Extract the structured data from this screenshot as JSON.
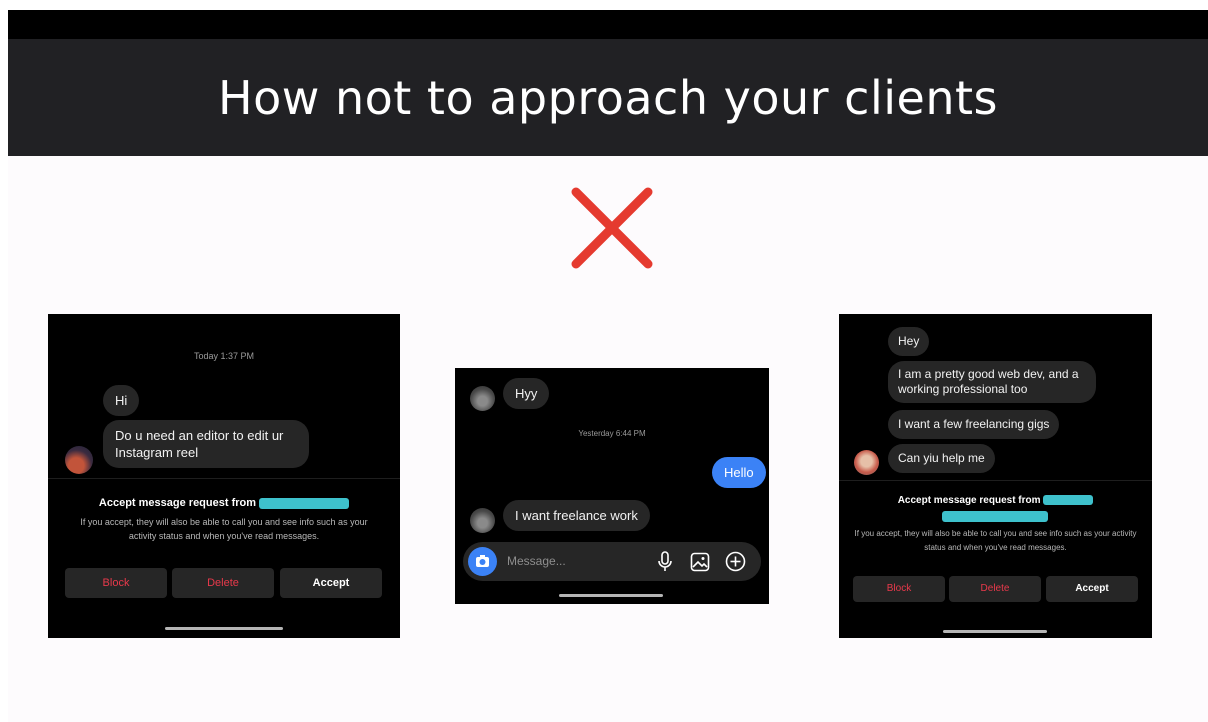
{
  "slide": {
    "title": "How not to approach your clients"
  },
  "colors": {
    "header_bg": "#212124",
    "x_mark": "#e53a2f",
    "sent_bubble": "#3b82f6",
    "danger": "#e8394b",
    "redaction": "#3ec1cc"
  },
  "shot1": {
    "timestamp": "Today 1:37 PM",
    "messages": [
      "Hi",
      "Do u need an editor to edit ur Instagram reel"
    ],
    "request_title": "Accept message request from",
    "request_body": "If you accept, they will also be able to call you and see info such as your activity status and when you've read messages.",
    "buttons": {
      "block": "Block",
      "delete": "Delete",
      "accept": "Accept"
    }
  },
  "shot2": {
    "received_1": "Hyy",
    "timestamp": "Yesterday 6:44 PM",
    "sent": "Hello",
    "received_2": "I want freelance work",
    "composer_placeholder": "Message..."
  },
  "shot3": {
    "messages": [
      "Hey",
      "I am a pretty good web dev, and a working professional too",
      "I want a few freelancing gigs",
      "Can yiu help me"
    ],
    "request_title": "Accept message request from",
    "request_body": "If you accept, they will also be able to call you and see info such as your activity status and when you've read messages.",
    "buttons": {
      "block": "Block",
      "delete": "Delete",
      "accept": "Accept"
    }
  }
}
